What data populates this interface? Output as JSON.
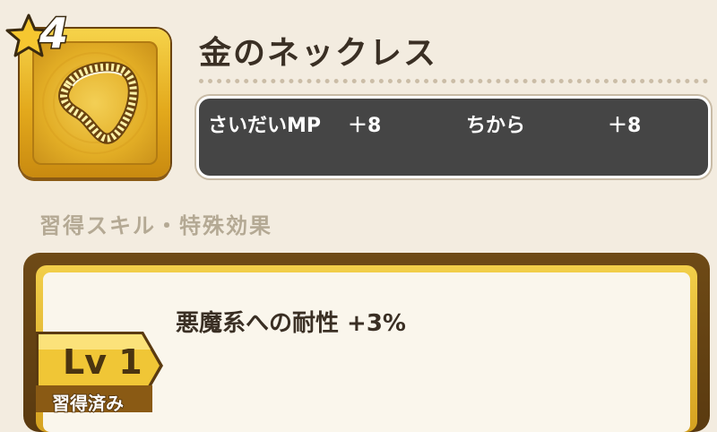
{
  "item": {
    "rarity": "4",
    "name": "金のネックレス",
    "icon": "gold-necklace-icon",
    "frame_color": "#e3a91c"
  },
  "stats": [
    {
      "label": "さいだいMP",
      "value": "＋8"
    },
    {
      "label": "ちから",
      "value": "＋8"
    }
  ],
  "section": {
    "label": "習得スキル・特殊効果"
  },
  "skill": {
    "level_label": "Lv 1",
    "status_label": "習得済み",
    "effect": "悪魔系への耐性 +3%"
  },
  "colors": {
    "background": "#f3ece0",
    "stats_bg": "#454545",
    "panel_border": "#6e4a16",
    "gold": "#f2cf4a"
  }
}
